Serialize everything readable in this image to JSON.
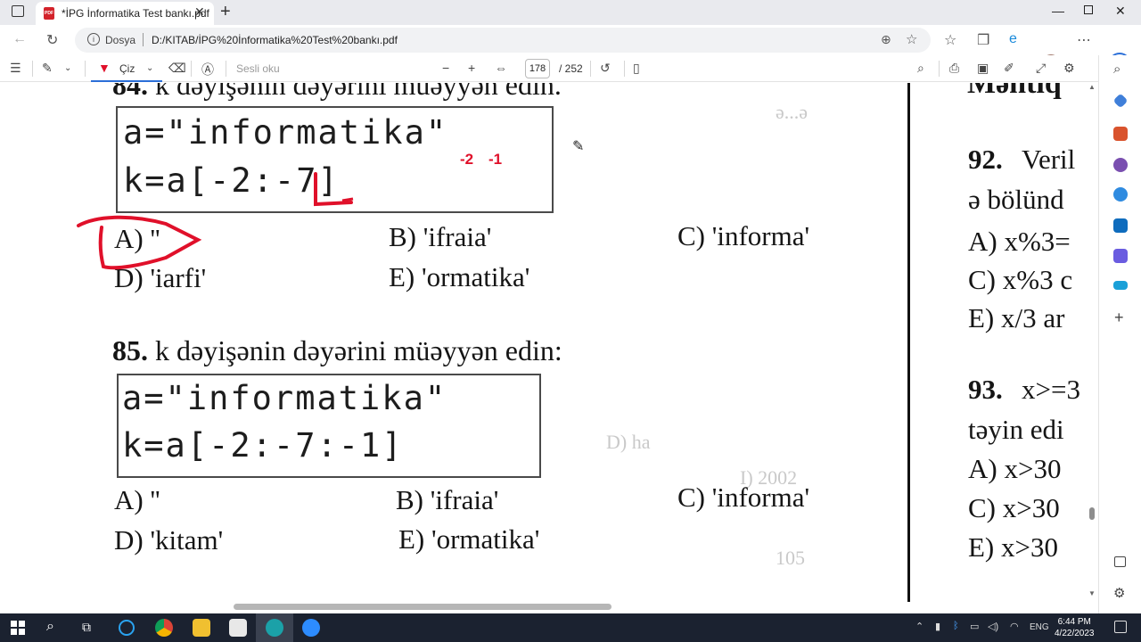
{
  "browser": {
    "tab_title": "*İPG İnformatika Test bankı.pdf",
    "url_scheme_label": "Dosya",
    "url": "D:/KITAB/İPG%20İnformatika%20Test%20bankı.pdf"
  },
  "pdf_toolbar": {
    "draw_label": "Çiz",
    "read_aloud_label": "Sesli oku",
    "current_page": "178",
    "total_pages": "/ 252"
  },
  "document": {
    "q84": {
      "number": "84.",
      "text": "k dəyişənin dəyərini müəyyən edin.",
      "code_line1": "a=\"informatika\"",
      "code_line2": "k=a[-2:-7]",
      "options": {
        "A": "A) ''",
        "B": "B) 'ifraia'",
        "C": "C) 'informa'",
        "D": "D) 'iarfi'",
        "E": "E) 'ormatika'"
      }
    },
    "q85": {
      "number": "85.",
      "text": "k dəyişənin dəyərini müəyyən edin:",
      "code_line1": "a=\"informatika\"",
      "code_line2": "k=a[-2:-7:-1]",
      "options": {
        "A": "A) ''",
        "B": "B) 'ifraia'",
        "C": "C) 'informa'",
        "D": "D) 'kitam'",
        "E": "E) 'ormatika'"
      }
    },
    "right_column": {
      "heading": "Məntiq",
      "q92_number": "92.",
      "q92_line1": "Veril",
      "q92_line2": "ə bölünd",
      "q92_optA": "A) x%3=",
      "q92_optC": "C) x%3 c",
      "q92_optE": "E) x/3 ar",
      "q93_number": "93.",
      "q93_line1": "x>=3",
      "q93_line2": "təyin edi",
      "q93_optA": "A) x>30",
      "q93_optC": "C) x>30",
      "q93_optE": "E) x>30"
    },
    "annotations": {
      "index_minus2": "-2",
      "index_minus1": "-1"
    }
  },
  "taskbar": {
    "time": "6:44 PM",
    "date": "4/22/2023",
    "language": "ENG"
  },
  "colors": {
    "annotation_red": "#e0102a",
    "taskbar_bg": "#1b2230",
    "accent_blue": "#2b6fd8"
  }
}
